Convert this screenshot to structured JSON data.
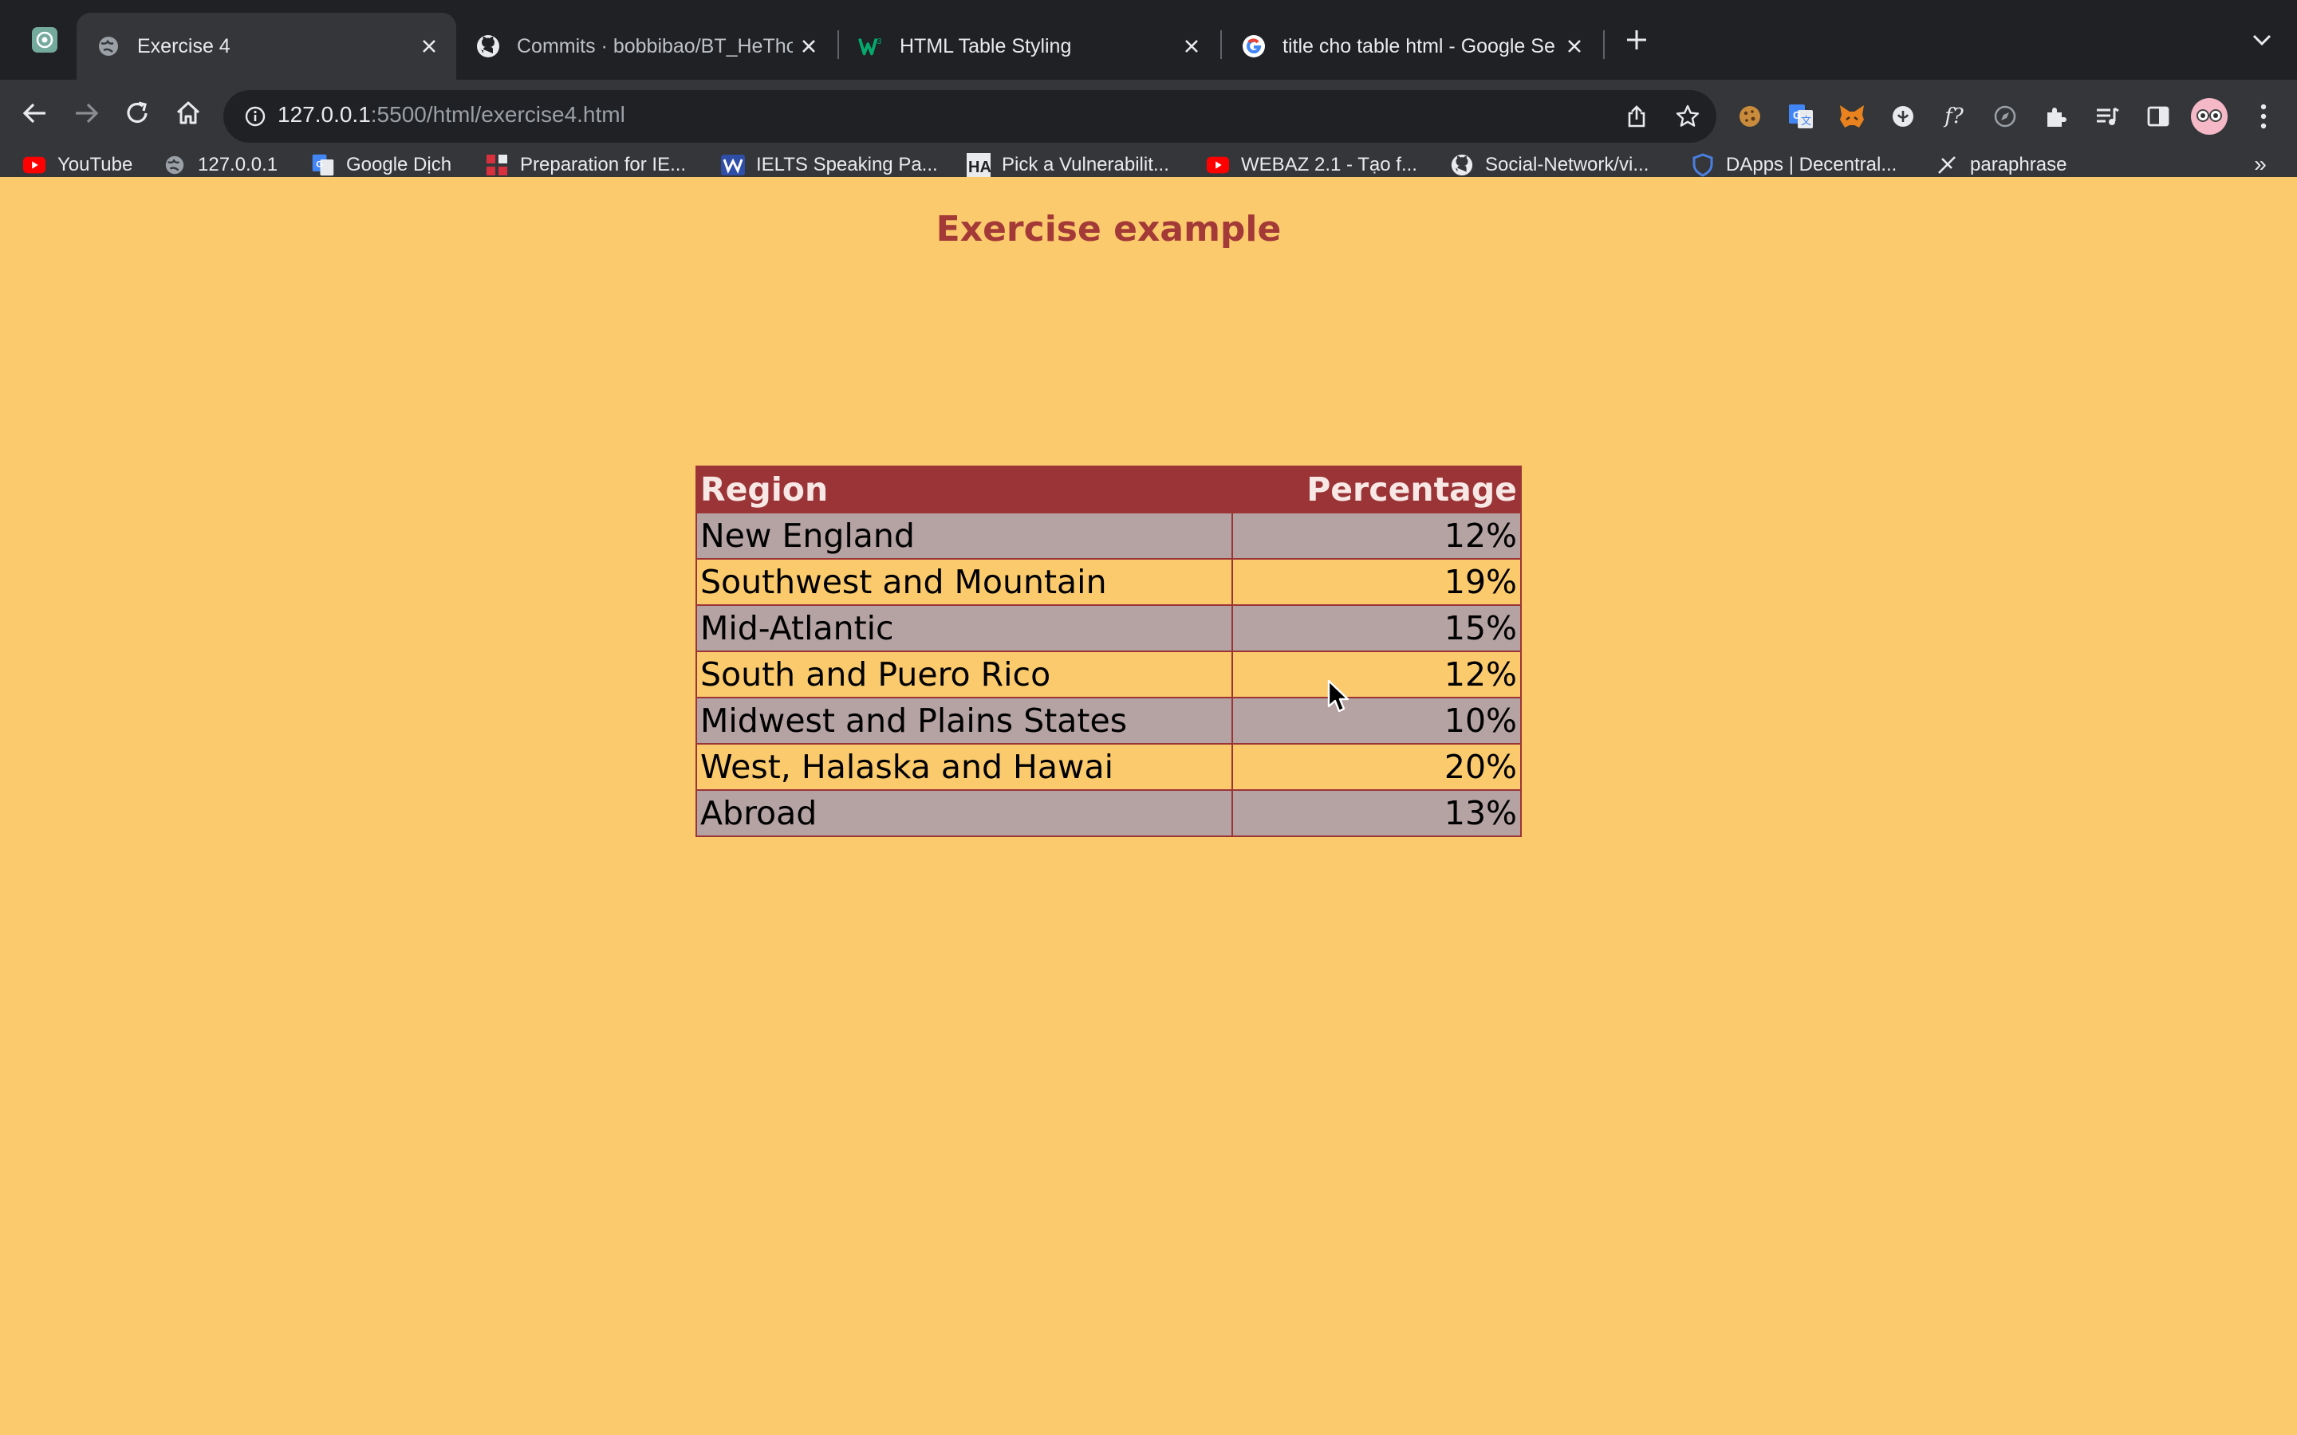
{
  "browser": {
    "tabs": [
      {
        "title": "Exercise 4",
        "active": true,
        "icon": "globe-icon"
      },
      {
        "title": "Commits · bobbibao/BT_HeTho",
        "active": false,
        "icon": "github-icon"
      },
      {
        "title": "HTML Table Styling",
        "active": false,
        "icon": "w3schools-icon"
      },
      {
        "title": "title cho table html - Google Se",
        "active": false,
        "icon": "google-icon"
      }
    ],
    "address": {
      "host": "127.0.0.1",
      "path": ":5500/html/exercise4.html"
    },
    "bookmarks": [
      {
        "label": "YouTube",
        "icon": "youtube-icon"
      },
      {
        "label": "127.0.0.1",
        "icon": "globe-icon"
      },
      {
        "label": "Google Dịch",
        "icon": "google-translate-icon"
      },
      {
        "label": "Preparation for IE...",
        "icon": "grid-icon"
      },
      {
        "label": "IELTS Speaking Pa...",
        "icon": "ielts-icon"
      },
      {
        "label": "Pick a Vulnerabilit...",
        "icon": "ha-icon"
      },
      {
        "label": "WEBAZ 2.1 - Tạo f...",
        "icon": "youtube-icon"
      },
      {
        "label": "Social-Network/vi...",
        "icon": "github-icon"
      },
      {
        "label": "DApps | Decentral...",
        "icon": "shield-icon"
      },
      {
        "label": "paraphrase",
        "icon": "quill-icon"
      }
    ],
    "bookmarks_more": "»",
    "extension_fx_label": "f?"
  },
  "page": {
    "title": "Exercise example",
    "table": {
      "headers": [
        "Region",
        "Percentage"
      ],
      "rows": [
        [
          "New England",
          "12%"
        ],
        [
          "Southwest and Mountain",
          "19%"
        ],
        [
          "Mid-Atlantic",
          "15%"
        ],
        [
          "South and Puero Rico",
          "12%"
        ],
        [
          "Midwest and Plains States",
          "10%"
        ],
        [
          "West, Halaska and Hawai",
          "20%"
        ],
        [
          "Abroad",
          "13%"
        ]
      ]
    }
  },
  "colors": {
    "page_bg": "#fbca6d",
    "accent": "#9b3437",
    "title": "#a33a38",
    "odd_row": "#b5a2a3"
  }
}
